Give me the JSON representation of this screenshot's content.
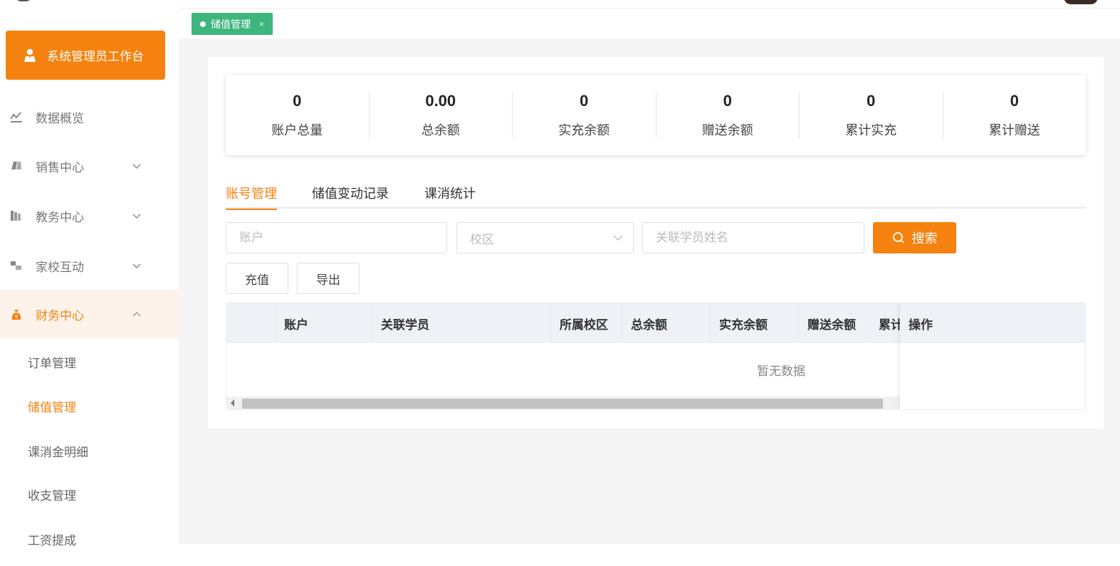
{
  "sidebar": {
    "workbench_label": "系统管理员工作台",
    "menu": [
      {
        "label": "数据概览",
        "icon": "chart-line-icon",
        "expandable": false
      },
      {
        "label": "销售中心",
        "icon": "tag-icon",
        "expandable": true,
        "expanded": false
      },
      {
        "label": "教务中心",
        "icon": "books-icon",
        "expandable": true,
        "expanded": false
      },
      {
        "label": "家校互动",
        "icon": "interaction-icon",
        "expandable": true,
        "expanded": false
      },
      {
        "label": "财务中心",
        "icon": "money-bag-icon",
        "expandable": true,
        "expanded": true,
        "active": true
      }
    ],
    "submenu": [
      {
        "label": "订单管理",
        "active": false
      },
      {
        "label": "储值管理",
        "active": true
      },
      {
        "label": "课消金明细",
        "active": false
      },
      {
        "label": "收支管理",
        "active": false
      },
      {
        "label": "工资提成",
        "active": false
      }
    ]
  },
  "tabs_bar": {
    "open_tag": {
      "label": "储值管理",
      "close": "×"
    }
  },
  "stats": [
    {
      "value": "0",
      "label": "账户总量"
    },
    {
      "value": "0.00",
      "label": "总余额"
    },
    {
      "value": "0",
      "label": "实充余额"
    },
    {
      "value": "0",
      "label": "赠送余额"
    },
    {
      "value": "0",
      "label": "累计实充"
    },
    {
      "value": "0",
      "label": "累计赠送"
    }
  ],
  "content_tabs": [
    {
      "label": "账号管理",
      "active": true
    },
    {
      "label": "储值变动记录",
      "active": false
    },
    {
      "label": "课消统计",
      "active": false
    }
  ],
  "filters": {
    "account_placeholder": "账户",
    "campus_placeholder": "校区",
    "student_placeholder": "关联学员姓名",
    "search_label": "搜索"
  },
  "actions": {
    "recharge_label": "充值",
    "export_label": "导出"
  },
  "table": {
    "columns": [
      "",
      "账户",
      "关联学员",
      "所属校区",
      "总余额",
      "实充余额",
      "赠送余额",
      "累计"
    ],
    "fixed_column": "操作",
    "empty_text": "暂无数据"
  },
  "colors": {
    "accent": "#f5820f",
    "tag_green": "#3eb57d",
    "active_menu_bg": "#fdf3ea",
    "header_bg": "#eef1f6"
  }
}
